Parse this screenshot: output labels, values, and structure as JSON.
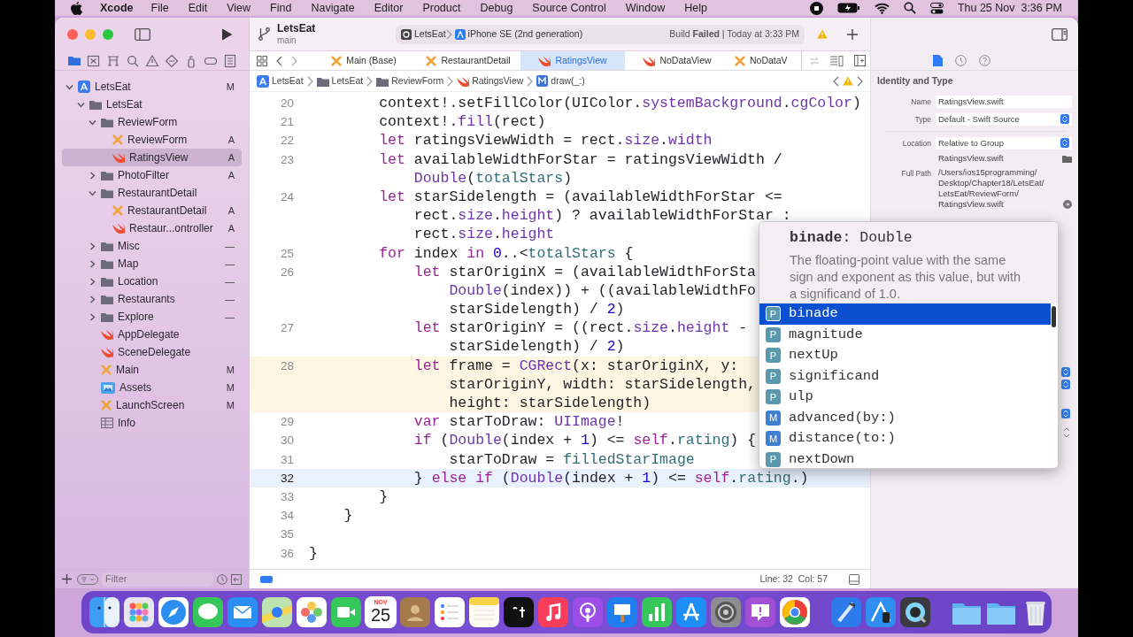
{
  "menu_bar": {
    "app_name": "Xcode",
    "items": [
      "File",
      "Edit",
      "View",
      "Find",
      "Navigate",
      "Editor",
      "Product",
      "Debug",
      "Source Control",
      "Window",
      "Help"
    ],
    "clock": "Thu 25 Nov  3:36 PM"
  },
  "toolbar": {
    "project": "LetsEat",
    "branch": "main",
    "scheme": "LetsEat",
    "destination": "iPhone SE (2nd generation)",
    "build_status": "Build **Failed** | Today at 3:33 PM"
  },
  "navigator": {
    "items": [
      {
        "label": "LetsEat",
        "kind": "project",
        "badge": "M",
        "expanded": true,
        "selected": false,
        "children": [
          {
            "label": "LetsEat",
            "kind": "folder",
            "expanded": true,
            "selected": false,
            "children": [
              {
                "label": "ReviewForm",
                "kind": "folder",
                "expanded": true,
                "selected": false,
                "children": [
                  {
                    "label": "ReviewForm",
                    "kind": "interface",
                    "badge": "A",
                    "selected": false
                  },
                  {
                    "label": "RatingsView",
                    "kind": "swift",
                    "badge": "A",
                    "selected": true
                  }
                ]
              },
              {
                "label": "PhotoFilter",
                "kind": "folder",
                "badge": "A",
                "expanded": false,
                "selected": false
              },
              {
                "label": "RestaurantDetail",
                "kind": "folder",
                "expanded": true,
                "selected": false,
                "children": [
                  {
                    "label": "RestaurantDetail",
                    "kind": "interface",
                    "badge": "A",
                    "selected": false
                  },
                  {
                    "label": "Restaur...ontroller",
                    "kind": "swift",
                    "badge": "A",
                    "selected": false
                  }
                ]
              },
              {
                "label": "Misc",
                "kind": "folder",
                "badge": "—",
                "expanded": false,
                "selected": false
              },
              {
                "label": "Map",
                "kind": "folder",
                "badge": "—",
                "expanded": false,
                "selected": false
              },
              {
                "label": "Location",
                "kind": "folder",
                "badge": "—",
                "expanded": false,
                "selected": false
              },
              {
                "label": "Restaurants",
                "kind": "folder",
                "badge": "—",
                "expanded": false,
                "selected": false
              },
              {
                "label": "Explore",
                "kind": "folder",
                "badge": "—",
                "expanded": false,
                "selected": false
              },
              {
                "label": "AppDelegate",
                "kind": "swift",
                "selected": false
              },
              {
                "label": "SceneDelegate",
                "kind": "swift",
                "selected": false
              },
              {
                "label": "Main",
                "kind": "interface",
                "badge": "M",
                "selected": false
              },
              {
                "label": "Assets",
                "kind": "assets",
                "badge": "M",
                "selected": false
              },
              {
                "label": "LaunchScreen",
                "kind": "interface",
                "badge": "M",
                "selected": false
              },
              {
                "label": "Info",
                "kind": "plist",
                "selected": false
              }
            ]
          }
        ]
      }
    ],
    "filter_placeholder": "Filter"
  },
  "tabs": [
    {
      "label": "Main (Base)",
      "kind": "interface",
      "selected": false
    },
    {
      "label": "RestaurantDetail",
      "kind": "interface",
      "selected": false
    },
    {
      "label": "RatingsView",
      "kind": "swift",
      "selected": true
    },
    {
      "label": "NoDataView",
      "kind": "swift",
      "selected": false
    },
    {
      "label": "NoDataV",
      "kind": "interface",
      "selected": false
    }
  ],
  "jump_bar": [
    {
      "label": "LetsEat",
      "kind": "project"
    },
    {
      "label": "LetsEat",
      "kind": "folder"
    },
    {
      "label": "ReviewForm",
      "kind": "folder"
    },
    {
      "label": "RatingsView",
      "kind": "swift"
    },
    {
      "label": "draw(_:)",
      "kind": "method"
    }
  ],
  "code": {
    "rows": [
      {
        "number": "20",
        "issue": false,
        "current": false,
        "segments": [
          {
            "kind": "plain",
            "text": "        context!.setFillColor(UIColor."
          },
          {
            "kind": "member",
            "text": "systemBackground"
          },
          {
            "kind": "plain",
            "text": "."
          },
          {
            "kind": "member",
            "text": "cgColor"
          },
          {
            "kind": "plain",
            "text": ")"
          }
        ]
      },
      {
        "number": "21",
        "issue": false,
        "current": false,
        "segments": [
          {
            "kind": "plain",
            "text": "        context!."
          },
          {
            "kind": "member",
            "text": "fill"
          },
          {
            "kind": "plain",
            "text": "(rect)"
          }
        ]
      },
      {
        "number": "22",
        "issue": false,
        "current": false,
        "segments": [
          {
            "kind": "keyword",
            "text": "        let"
          },
          {
            "kind": "plain",
            "text": " ratingsViewWidth = rect."
          },
          {
            "kind": "member",
            "text": "size"
          },
          {
            "kind": "plain",
            "text": "."
          },
          {
            "kind": "member",
            "text": "width"
          }
        ]
      },
      {
        "number": "23",
        "issue": false,
        "current": false,
        "segments": [
          {
            "kind": "keyword",
            "text": "        let"
          },
          {
            "kind": "plain",
            "text": " availableWidthForStar = ratingsViewWidth /"
          }
        ]
      },
      {
        "issue": false,
        "current": false,
        "segments": [
          {
            "kind": "type",
            "text": "            Double"
          },
          {
            "kind": "plain",
            "text": "("
          },
          {
            "kind": "local",
            "text": "totalStars"
          },
          {
            "kind": "plain",
            "text": ")"
          }
        ]
      },
      {
        "number": "24",
        "issue": false,
        "current": false,
        "segments": [
          {
            "kind": "keyword",
            "text": "        let"
          },
          {
            "kind": "plain",
            "text": " starSidelength = (availableWidthForStar <="
          }
        ]
      },
      {
        "issue": false,
        "current": false,
        "segments": [
          {
            "kind": "plain",
            "text": "            rect."
          },
          {
            "kind": "member",
            "text": "size"
          },
          {
            "kind": "plain",
            "text": "."
          },
          {
            "kind": "member",
            "text": "height"
          },
          {
            "kind": "plain",
            "text": ") ? availableWidthForStar :"
          }
        ]
      },
      {
        "issue": false,
        "current": false,
        "segments": [
          {
            "kind": "plain",
            "text": "            rect."
          },
          {
            "kind": "member",
            "text": "size"
          },
          {
            "kind": "plain",
            "text": "."
          },
          {
            "kind": "member",
            "text": "height"
          }
        ]
      },
      {
        "number": "25",
        "issue": false,
        "current": false,
        "segments": [
          {
            "kind": "keyword",
            "text": "        for"
          },
          {
            "kind": "plain",
            "text": " index "
          },
          {
            "kind": "keyword",
            "text": "in"
          },
          {
            "kind": "number",
            "text": " 0"
          },
          {
            "kind": "plain",
            "text": "..<"
          },
          {
            "kind": "local",
            "text": "totalStars"
          },
          {
            "kind": "plain",
            "text": " {"
          }
        ]
      },
      {
        "number": "26",
        "issue": false,
        "current": false,
        "segments": [
          {
            "kind": "keyword",
            "text": "            let"
          },
          {
            "kind": "plain",
            "text": " starOriginX = (availableWidthForSta"
          }
        ]
      },
      {
        "issue": false,
        "current": false,
        "segments": [
          {
            "kind": "type",
            "text": "                Double"
          },
          {
            "kind": "plain",
            "text": "(index)) + ((availableWidthFo"
          }
        ]
      },
      {
        "issue": false,
        "current": false,
        "segments": [
          {
            "kind": "plain",
            "text": "                starSidelength) / "
          },
          {
            "kind": "number",
            "text": "2"
          },
          {
            "kind": "plain",
            "text": ")"
          }
        ]
      },
      {
        "number": "27",
        "issue": false,
        "current": false,
        "segments": [
          {
            "kind": "keyword",
            "text": "            let"
          },
          {
            "kind": "plain",
            "text": " starOriginY = ((rect."
          },
          {
            "kind": "member",
            "text": "size"
          },
          {
            "kind": "plain",
            "text": "."
          },
          {
            "kind": "member",
            "text": "height"
          },
          {
            "kind": "plain",
            "text": " -"
          }
        ]
      },
      {
        "issue": false,
        "current": false,
        "segments": [
          {
            "kind": "plain",
            "text": "                starSidelength) / "
          },
          {
            "kind": "number",
            "text": "2"
          },
          {
            "kind": "plain",
            "text": ")"
          }
        ]
      },
      {
        "number": "28",
        "issue": true,
        "current": false,
        "segments": [
          {
            "kind": "keyword",
            "text": "            let"
          },
          {
            "kind": "plain",
            "text": " frame = "
          },
          {
            "kind": "type",
            "text": "CGRect"
          },
          {
            "kind": "plain",
            "text": "(x: starOriginX, y:"
          }
        ]
      },
      {
        "issue": true,
        "current": false,
        "segments": [
          {
            "kind": "plain",
            "text": "                starOriginY, width: starSidelength,"
          }
        ]
      },
      {
        "issue": true,
        "current": false,
        "segments": [
          {
            "kind": "plain",
            "text": "                height: starSidelength)"
          }
        ]
      },
      {
        "number": "29",
        "issue": false,
        "current": false,
        "segments": [
          {
            "kind": "keyword",
            "text": "            var"
          },
          {
            "kind": "plain",
            "text": " starToDraw: "
          },
          {
            "kind": "type",
            "text": "UIImage"
          },
          {
            "kind": "plain",
            "text": "!"
          }
        ]
      },
      {
        "number": "30",
        "issue": false,
        "current": false,
        "segments": [
          {
            "kind": "keyword",
            "text": "            if"
          },
          {
            "kind": "plain",
            "text": " ("
          },
          {
            "kind": "type",
            "text": "Double"
          },
          {
            "kind": "plain",
            "text": "(index + "
          },
          {
            "kind": "number",
            "text": "1"
          },
          {
            "kind": "plain",
            "text": ") <= "
          },
          {
            "kind": "keyword",
            "text": "self"
          },
          {
            "kind": "plain",
            "text": "."
          },
          {
            "kind": "local",
            "text": "rating"
          },
          {
            "kind": "plain",
            "text": ") {"
          }
        ]
      },
      {
        "number": "31",
        "issue": false,
        "current": false,
        "segments": [
          {
            "kind": "plain",
            "text": "                starToDraw = "
          },
          {
            "kind": "local",
            "text": "filledStarImage"
          }
        ]
      },
      {
        "number": "32",
        "issue": false,
        "current": true,
        "segments": [
          {
            "kind": "plain",
            "text": "            } "
          },
          {
            "kind": "keyword",
            "text": "else if"
          },
          {
            "kind": "plain",
            "text": " ("
          },
          {
            "kind": "type",
            "text": "Double"
          },
          {
            "kind": "plain",
            "text": "(index + "
          },
          {
            "kind": "number",
            "text": "1"
          },
          {
            "kind": "plain",
            "text": ") <= "
          },
          {
            "kind": "keyword",
            "text": "self"
          },
          {
            "kind": "plain",
            "text": "."
          },
          {
            "kind": "local",
            "text": "rating"
          },
          {
            "kind": "plain",
            "text": ".)"
          }
        ]
      },
      {
        "number": "33",
        "issue": false,
        "current": false,
        "segments": [
          {
            "kind": "plain",
            "text": "        }"
          }
        ]
      },
      {
        "number": "34",
        "issue": false,
        "current": false,
        "segments": [
          {
            "kind": "plain",
            "text": "    }"
          }
        ]
      },
      {
        "number": "35",
        "issue": false,
        "current": false
      },
      {
        "number": "36",
        "issue": false,
        "current": false,
        "segments": [
          {
            "kind": "plain",
            "text": "}"
          }
        ]
      }
    ]
  },
  "completion": {
    "signature": "**binade**: Double",
    "description": "The floating-point value with the same sign and exponent as this value, but with a significand of 1.0.",
    "items": [
      {
        "badge": "P",
        "kind": "property",
        "label": "binade",
        "selected": true
      },
      {
        "badge": "P",
        "kind": "property",
        "label": "magnitude",
        "selected": false
      },
      {
        "badge": "P",
        "kind": "property",
        "label": "nextUp",
        "selected": false
      },
      {
        "badge": "P",
        "kind": "property",
        "label": "significand",
        "selected": false
      },
      {
        "badge": "P",
        "kind": "property",
        "label": "ulp",
        "selected": false
      },
      {
        "badge": "M",
        "kind": "method",
        "label": "advanced(by:)",
        "selected": false
      },
      {
        "badge": "M",
        "kind": "method",
        "label": "distance(to:)",
        "selected": false
      },
      {
        "badge": "P",
        "kind": "property",
        "label": "nextDown",
        "selected": false
      }
    ]
  },
  "status_bar": {
    "position": "Line: 32  Col: 57"
  },
  "inspector": {
    "section": "Identity and Type",
    "name_label": "Name",
    "name": "RatingsView.swift",
    "type_label": "Type",
    "type": "Default - Swift Source",
    "location_label": "Location",
    "location": "Relative to Group",
    "location_file": "RatingsView.swift",
    "full_path_label": "Full Path",
    "full_path": [
      "/Users/ios15programming/",
      "Desktop/Chapter18/LetsEat/",
      "LetsEat/ReviewForm/",
      "RatingsView.swift"
    ]
  },
  "dock": {
    "calendar_month": "NOV",
    "calendar_day": "25"
  }
}
